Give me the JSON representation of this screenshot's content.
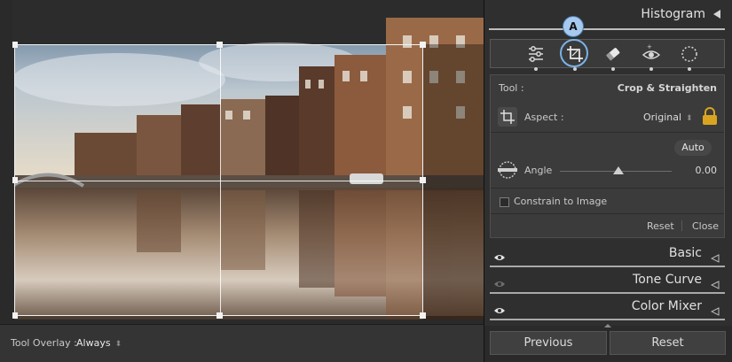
{
  "canvas": {
    "tool_overlay_label": "Tool Overlay :",
    "tool_overlay_value": "Always"
  },
  "panel": {
    "histogram_title": "Histogram",
    "annotation_badge": "A",
    "tools": [
      {
        "name": "edit-sliders-icon"
      },
      {
        "name": "crop-icon",
        "active": true
      },
      {
        "name": "healing-eraser-icon"
      },
      {
        "name": "red-eye-icon"
      },
      {
        "name": "masking-icon"
      }
    ],
    "crop": {
      "tool_label": "Tool :",
      "tool_value": "Crop & Straighten",
      "aspect_label": "Aspect :",
      "aspect_value": "Original",
      "auto_label": "Auto",
      "angle_label": "Angle",
      "angle_value": "0.00",
      "constrain_label": "Constrain to Image",
      "reset_label": "Reset",
      "close_label": "Close"
    },
    "sections": [
      {
        "name": "Basic",
        "eye_active": true
      },
      {
        "name": "Tone Curve",
        "eye_active": false
      },
      {
        "name": "Color Mixer",
        "eye_active": true
      }
    ],
    "buttons": {
      "previous_label": "Previous",
      "reset_label": "Reset"
    }
  },
  "colors": {
    "accent": "#7ab3e8",
    "panel_bg": "#2f2f2f",
    "lock": "#d9a520"
  }
}
